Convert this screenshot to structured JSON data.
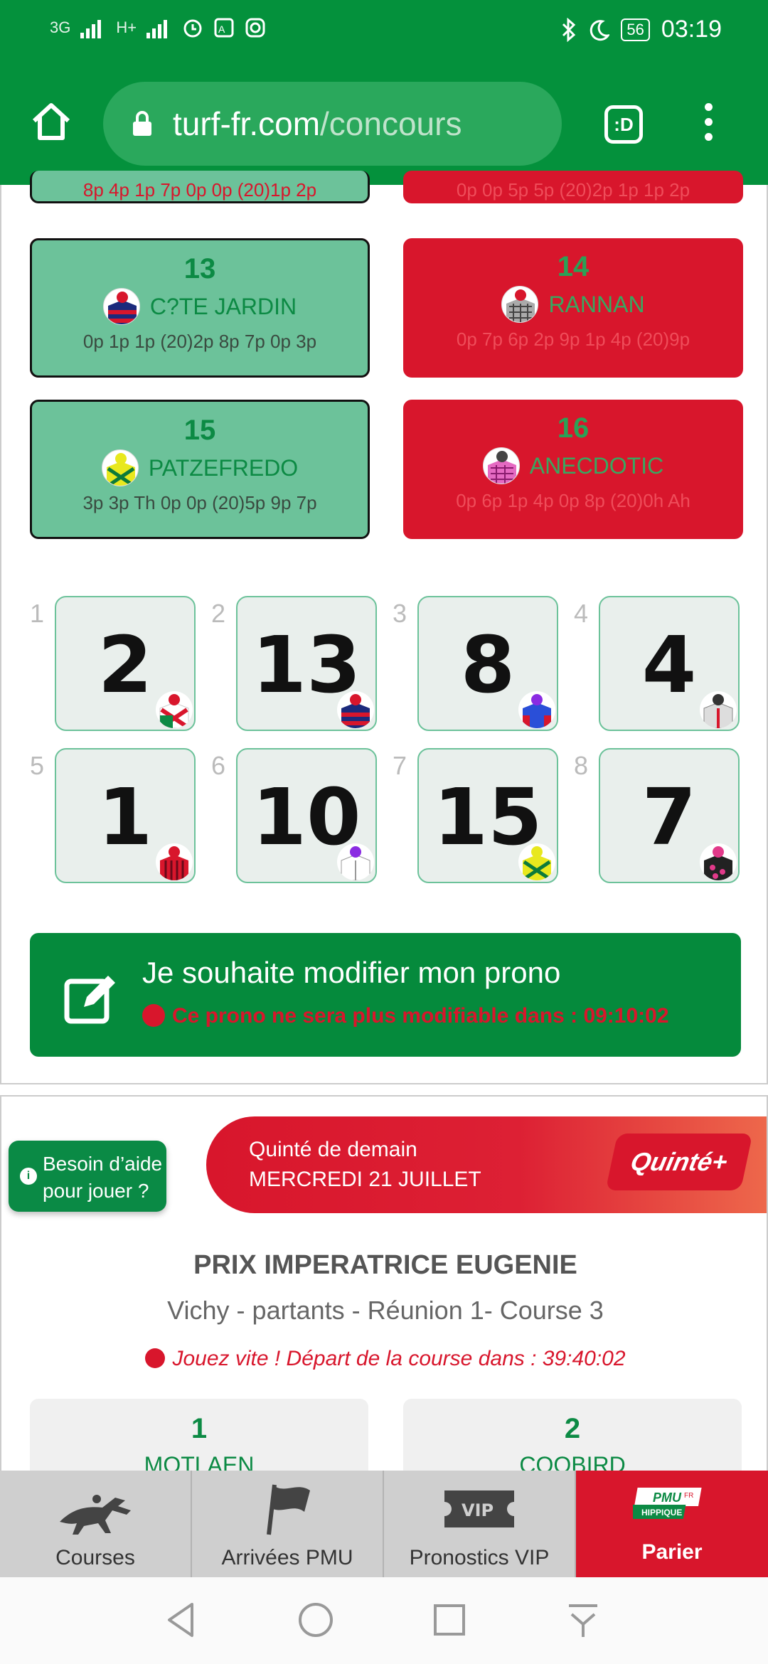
{
  "status": {
    "signal1": "3G",
    "signal2": "H+",
    "battery": "56",
    "time": "03:19"
  },
  "browser": {
    "url_host": "turf-fr.com",
    "url_path": "/concours",
    "tab_label": ":D"
  },
  "cards_top": [
    {
      "form": "8p 4p 1p 7p 0p 0p (20)1p 2p"
    },
    {
      "form": "0p 0p 5p 5p (20)2p 1p 1p 2p"
    }
  ],
  "cards": [
    {
      "num": "13",
      "name": "C?TE JARDIN",
      "form": "0p 1p 1p (20)2p 8p 7p 0p 3p",
      "state": "selected"
    },
    {
      "num": "14",
      "name": "RANNAN",
      "form": "0p 7p 6p 2p 9p 1p 4p (20)9p",
      "state": "red"
    },
    {
      "num": "15",
      "name": "PATZEFREDO",
      "form": "3p 3p Th 0p 0p (20)5p 9p 7p",
      "state": "selected"
    },
    {
      "num": "16",
      "name": "ANECDOTIC",
      "form": "0p 6p 1p 4p 0p 8p (20)0h Ah",
      "state": "red"
    }
  ],
  "picks": [
    {
      "rank": "1",
      "horse": "2"
    },
    {
      "rank": "2",
      "horse": "13"
    },
    {
      "rank": "3",
      "horse": "8"
    },
    {
      "rank": "4",
      "horse": "4"
    },
    {
      "rank": "5",
      "horse": "1"
    },
    {
      "rank": "6",
      "horse": "10"
    },
    {
      "rank": "7",
      "horse": "15"
    },
    {
      "rank": "8",
      "horse": "7"
    }
  ],
  "modify": {
    "title": "Je souhaite modifier mon prono",
    "countdown": "Ce prono ne sera plus modifiable dans : 09:10:02"
  },
  "help": {
    "line1": "Besoin d’aide",
    "line2": "pour jouer ?"
  },
  "banner": {
    "line1": "Quinté de demain",
    "line2": "MERCREDI 21 JUILLET",
    "logo": "Quinté+"
  },
  "race": {
    "title": "PRIX IMPERATRICE EUGENIE",
    "subtitle": "Vichy - partants - Réunion 1- Course 3",
    "warning": "Jouez vite ! Départ de la course dans : 39:40:02",
    "runners": [
      {
        "num": "1",
        "name": "MOTLAEN"
      },
      {
        "num": "2",
        "name": "COOBIRD"
      }
    ]
  },
  "nav": [
    {
      "label": "Courses",
      "icon": "horse-racing-icon"
    },
    {
      "label": "Arrivées PMU",
      "icon": "flag-icon"
    },
    {
      "label": "Pronostics VIP",
      "icon": "vip-ticket-icon"
    },
    {
      "label": "Parier",
      "icon": "pmu-hippique-logo"
    }
  ],
  "pmu_logo": {
    "top": "PMU",
    "fr": "FR",
    "bottom": "HIPPIQUE"
  },
  "colors": {
    "brand_green": "#04913c",
    "card_green": "#6cc29a",
    "red": "#d8162c"
  }
}
